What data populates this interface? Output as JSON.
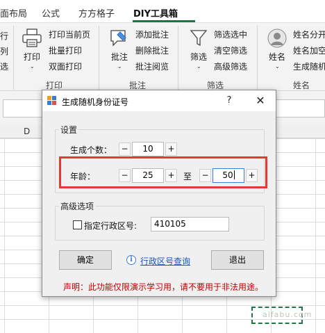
{
  "ribbon": {
    "tabs": [
      {
        "label": "面布局"
      },
      {
        "label": "公式"
      },
      {
        "label": "方方格子"
      },
      {
        "label": "DIY工具箱",
        "active": true
      }
    ],
    "print_group": {
      "print_label": "打印",
      "items": [
        "打印当前页",
        "批量打印",
        "双面打印"
      ],
      "group_label": "打印"
    },
    "comment_group": {
      "button_label": "批注",
      "items": [
        "添加批注",
        "删除批注",
        "批注阅览"
      ],
      "group_label": "批注"
    },
    "filter_group": {
      "button_label": "筛选",
      "items": [
        "筛选选中",
        "清空筛选",
        "高级筛选"
      ],
      "group_label": "筛选"
    },
    "name_group": {
      "button_label": "姓名",
      "items": [
        "姓名分开",
        "姓名加空",
        "生成随机"
      ],
      "group_label": "姓名"
    },
    "partial_left_chars": [
      "行",
      "列",
      "选"
    ]
  },
  "sheet": {
    "visible_column": "D",
    "watermark": "aifabu.com"
  },
  "dialog": {
    "title": "生成随机身份证号",
    "help_label": "?",
    "close_label": "✕",
    "settings": {
      "title": "设置",
      "count_label": "生成个数：",
      "count_value": "10",
      "age_label": "年龄：",
      "age_min": "25",
      "age_to": "至",
      "age_max": "50",
      "minus": "−",
      "plus": "+"
    },
    "advanced": {
      "title": "高级选项",
      "checkbox_label": "指定行政区号:",
      "checked": false,
      "region_code": "410105"
    },
    "ok_label": "确定",
    "info_glyph": "i",
    "lookup_link": "行政区号查询",
    "exit_label": "退出",
    "notice": "声明：此功能仅限演示学习用，请不要用于非法用途。"
  }
}
